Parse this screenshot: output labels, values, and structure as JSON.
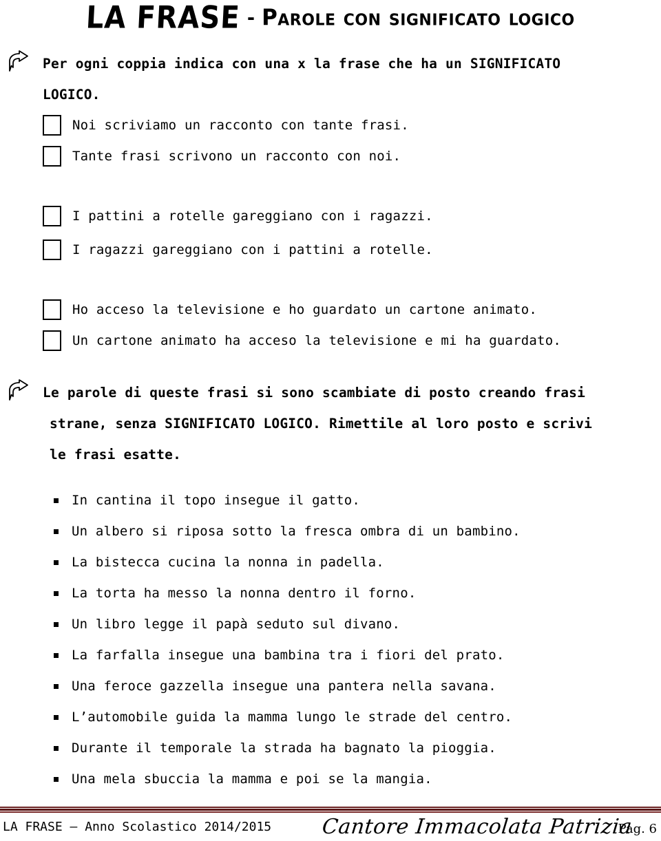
{
  "title": {
    "main": "LA FRASE",
    "dash": "-",
    "subtitle": "Parole con significato logico"
  },
  "instructions": [
    {
      "icon": "bent-arrow-icon",
      "lines": [
        "Per ogni coppia indica con una x la frase che ha un SIGNIFICATO",
        "LOGICO."
      ]
    },
    {
      "icon": "bent-arrow-icon",
      "lines": [
        "Le parole di queste frasi si sono scambiate di posto creando frasi",
        "strane, senza SIGNIFICATO LOGICO. Rimettile al loro posto e scrivi",
        "le frasi esatte."
      ]
    }
  ],
  "checkbox_items": [
    {
      "checked": false,
      "text": "Noi scriviamo un racconto con tante frasi."
    },
    {
      "checked": false,
      "text": "Tante frasi scrivono un racconto con noi."
    },
    {
      "checked": false,
      "text": "I pattini a rotelle gareggiano con i ragazzi."
    },
    {
      "checked": false,
      "text": "I ragazzi gareggiano con i pattini a rotelle."
    },
    {
      "checked": false,
      "text": "Ho acceso la televisione e ho guardato un cartone animato."
    },
    {
      "checked": false,
      "text": "Un cartone animato ha acceso la televisione e mi ha guardato."
    }
  ],
  "bullet_items": [
    "In cantina il topo insegue il gatto.",
    "Un albero si riposa sotto la fresca ombra di un bambino.",
    "La bistecca cucina la nonna in padella.",
    "La torta ha messo la nonna dentro il forno.",
    "Un libro legge il papà seduto sul divano.",
    "La farfalla insegue una bambina tra i fiori del prato.",
    "Una feroce gazzella insegue una pantera nella savana.",
    "L’automobile guida la mamma lungo le strade del centro.",
    "Durante il temporale la strada ha bagnato la pioggia.",
    "Una mela sbuccia la mamma e poi se la mangia."
  ],
  "footer": {
    "left": "LA FRASE – Anno Scolastico 2014/2015",
    "signature": "Cantore Immacolata Patrizia",
    "page": "Pag. 6",
    "rule_color": "#5a1717"
  }
}
